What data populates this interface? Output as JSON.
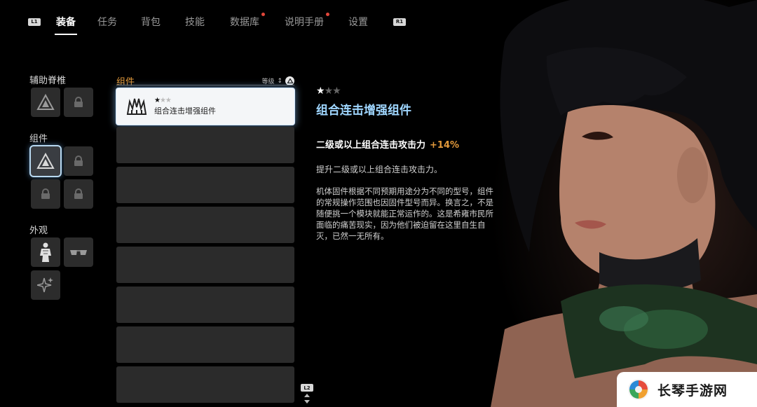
{
  "nav": {
    "left_button": "L1",
    "right_button": "R1",
    "tabs": [
      {
        "label": "装备",
        "active": true,
        "dot": false
      },
      {
        "label": "任务",
        "active": false,
        "dot": false
      },
      {
        "label": "背包",
        "active": false,
        "dot": false
      },
      {
        "label": "技能",
        "active": false,
        "dot": false
      },
      {
        "label": "数据库",
        "active": false,
        "dot": true
      },
      {
        "label": "说明手册",
        "active": false,
        "dot": true
      },
      {
        "label": "设置",
        "active": false,
        "dot": false
      }
    ]
  },
  "sidebar": {
    "sections": [
      {
        "label": "辅助脊椎",
        "slots": [
          "triangle-emblem-icon",
          "lock-icon"
        ]
      },
      {
        "label": "组件",
        "slots": [
          "triangle-emblem-icon",
          "lock-icon",
          "lock-icon",
          "lock-icon"
        ]
      },
      {
        "label": "外观",
        "slots": [
          "outfit-icon",
          "sunglasses-icon",
          "sparkle-icon"
        ]
      }
    ]
  },
  "component_list": {
    "title": "组件",
    "sort_label": "等级",
    "sort_arrow": "↕",
    "items": [
      {
        "name": "组合连击增强组件",
        "stars": 1,
        "max_stars": 3,
        "icon": "crown-claw-icon",
        "selected": true
      }
    ],
    "empty_slots": 7,
    "scroll_button": "L2"
  },
  "detail": {
    "stars": 1,
    "max_stars": 3,
    "title": "组合连击增强组件",
    "stat_label": "二级或以上组合连击攻击力",
    "stat_value": "+14%",
    "short_desc": "提升二级或以上组合连击攻击力。",
    "long_desc_lines": [
      "机体固件根据不同预期用途分为不同的型号，组件",
      "的常规操作范围也因固件型号而异。换言之，不是",
      "随便挑一个模块就能正常运作的。这是希雍市民所",
      "面临的痛苦现实，因为他们被迫留在这里自生自",
      "灭，已然一无所有。"
    ]
  },
  "watermark": {
    "text": "长琴手游网"
  },
  "colors": {
    "accent_orange": "#e39a3b",
    "title_blue": "#9fd6ff",
    "dot_red": "#e2463a"
  }
}
